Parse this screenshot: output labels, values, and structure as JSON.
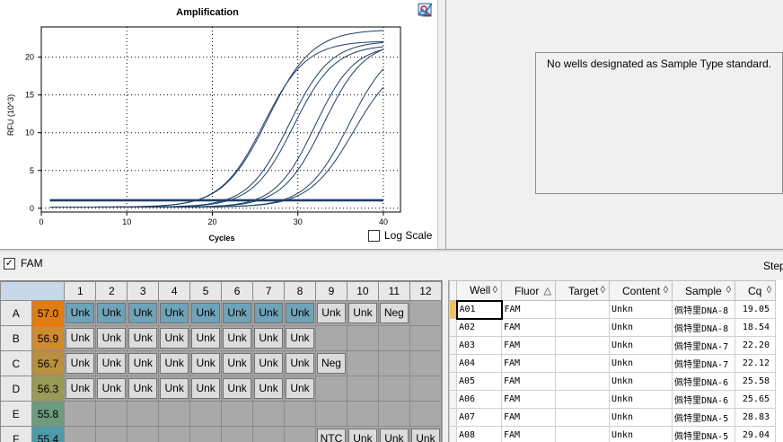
{
  "chart": {
    "title": "Amplification",
    "xlabel": "Cycles",
    "ylabel": "RFU (10^3)",
    "x_ticks": [
      "0",
      "10",
      "20",
      "30",
      "40"
    ],
    "y_ticks": [
      "0",
      "5",
      "10",
      "15",
      "20"
    ],
    "log_scale_label": "Log Scale",
    "log_scale_checked": false,
    "line_color": "#1f3f66"
  },
  "chart_data": {
    "type": "line",
    "title": "Amplification",
    "xlabel": "Cycles",
    "ylabel": "RFU (10^3)",
    "xlim": [
      0,
      42
    ],
    "ylim": [
      -0.5,
      24
    ],
    "grid": true,
    "series_params": [
      {
        "plateau": 23.5,
        "mid": 26.5,
        "slope": 2.6
      },
      {
        "plateau": 22.0,
        "mid": 26.0,
        "slope": 2.5
      },
      {
        "plateau": 22.0,
        "mid": 29.0,
        "slope": 2.4
      },
      {
        "plateau": 21.5,
        "mid": 29.5,
        "slope": 2.4
      },
      {
        "plateau": 21.5,
        "mid": 32.0,
        "slope": 2.3
      },
      {
        "plateau": 22.0,
        "mid": 33.0,
        "slope": 2.4
      },
      {
        "plateau": 22.0,
        "mid": 36.0,
        "slope": 2.5
      },
      {
        "plateau": 20.0,
        "mid": 36.5,
        "slope": 2.6
      },
      {
        "plateau": 1.0,
        "mid": 0,
        "slope": 0
      },
      {
        "plateau": 1.1,
        "mid": 0,
        "slope": 0
      }
    ]
  },
  "toolbar": {
    "icons": [
      "copy-icon",
      "export-icon",
      "save-image-icon",
      "zoom-icon",
      "chart-options-icon"
    ]
  },
  "standards": {
    "message": "No wells designated as Sample Type standard."
  },
  "fluor": {
    "label": "FAM",
    "checked": true,
    "step_label": "Step"
  },
  "plate": {
    "columns": [
      "1",
      "2",
      "3",
      "4",
      "5",
      "6",
      "7",
      "8",
      "9",
      "10",
      "11",
      "12"
    ],
    "rows": [
      {
        "label": "A",
        "temp": "57.0",
        "color": "#e07d10",
        "wells": [
          "Unk",
          "Unk",
          "Unk",
          "Unk",
          "Unk",
          "Unk",
          "Unk",
          "Unk",
          "Unk",
          "Unk",
          "Neg",
          ""
        ],
        "selected": [
          true,
          true,
          true,
          true,
          true,
          true,
          true,
          true,
          false,
          false,
          false,
          false
        ]
      },
      {
        "label": "B",
        "temp": "56.9",
        "color": "#d08a30",
        "wells": [
          "Unk",
          "Unk",
          "Unk",
          "Unk",
          "Unk",
          "Unk",
          "Unk",
          "Unk",
          "",
          "",
          "",
          ""
        ],
        "selected": [
          false,
          false,
          false,
          false,
          false,
          false,
          false,
          false,
          false,
          false,
          false,
          false
        ]
      },
      {
        "label": "C",
        "temp": "56.7",
        "color": "#b89040",
        "wells": [
          "Unk",
          "Unk",
          "Unk",
          "Unk",
          "Unk",
          "Unk",
          "Unk",
          "Unk",
          "Neg",
          "",
          "",
          ""
        ],
        "selected": [
          false,
          false,
          false,
          false,
          false,
          false,
          false,
          false,
          false,
          false,
          false,
          false
        ]
      },
      {
        "label": "D",
        "temp": "56.3",
        "color": "#9a9a58",
        "wells": [
          "Unk",
          "Unk",
          "Unk",
          "Unk",
          "Unk",
          "Unk",
          "Unk",
          "Unk",
          "",
          "",
          "",
          ""
        ],
        "selected": [
          false,
          false,
          false,
          false,
          false,
          false,
          false,
          false,
          false,
          false,
          false,
          false
        ]
      },
      {
        "label": "E",
        "temp": "55.8",
        "color": "#6e9a80",
        "wells": [
          "",
          "",
          "",
          "",
          "",
          "",
          "",
          "",
          "",
          "",
          "",
          ""
        ],
        "selected": [
          false,
          false,
          false,
          false,
          false,
          false,
          false,
          false,
          false,
          false,
          false,
          false
        ]
      },
      {
        "label": "F",
        "temp": "55.4",
        "color": "#4f9aa8",
        "wells": [
          "",
          "",
          "",
          "",
          "",
          "",
          "",
          "",
          "NTC",
          "Unk",
          "Unk",
          "Unk"
        ],
        "selected": [
          false,
          false,
          false,
          false,
          false,
          false,
          false,
          false,
          false,
          false,
          false,
          false
        ]
      }
    ]
  },
  "results": {
    "headers": [
      "Well",
      "Fluor",
      "Target",
      "Content",
      "Sample",
      "Cq"
    ],
    "sort_icons": [
      "◊",
      "△",
      "◊",
      "◊",
      "◊",
      "◊"
    ],
    "rows": [
      {
        "well": "A01",
        "fluor": "FAM",
        "target": "",
        "content": "Unkn",
        "sample": "佩特里DNA-8",
        "cq": "19.05"
      },
      {
        "well": "A02",
        "fluor": "FAM",
        "target": "",
        "content": "Unkn",
        "sample": "佩特里DNA-8",
        "cq": "18.54"
      },
      {
        "well": "A03",
        "fluor": "FAM",
        "target": "",
        "content": "Unkn",
        "sample": "佩特里DNA-7",
        "cq": "22.20"
      },
      {
        "well": "A04",
        "fluor": "FAM",
        "target": "",
        "content": "Unkn",
        "sample": "佩特里DNA-7",
        "cq": "22.12"
      },
      {
        "well": "A05",
        "fluor": "FAM",
        "target": "",
        "content": "Unkn",
        "sample": "佩特里DNA-6",
        "cq": "25.58"
      },
      {
        "well": "A06",
        "fluor": "FAM",
        "target": "",
        "content": "Unkn",
        "sample": "佩特里DNA-6",
        "cq": "25.65"
      },
      {
        "well": "A07",
        "fluor": "FAM",
        "target": "",
        "content": "Unkn",
        "sample": "佩特里DNA-5",
        "cq": "28.83"
      },
      {
        "well": "A08",
        "fluor": "FAM",
        "target": "",
        "content": "Unkn",
        "sample": "佩特里DNA-5",
        "cq": "29.04"
      }
    ]
  }
}
